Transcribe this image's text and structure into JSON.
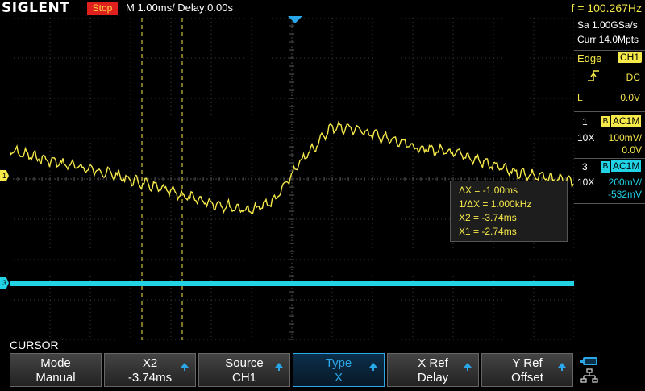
{
  "header": {
    "brand": "SIGLENT",
    "run_state": "Stop",
    "timebase": "M 1.00ms/ Delay:0.00s",
    "frequency": "f = 100.267Hz"
  },
  "acquisition": {
    "sample_rate": "Sa 1.00GSa/s",
    "memory": "Curr 14.0Mpts"
  },
  "trigger": {
    "type_label": "Edge",
    "source": "CH1",
    "coupling": "DC",
    "level_label": "L",
    "level_value": "0.0V"
  },
  "channels": [
    {
      "number": "1",
      "bw": "B",
      "coupling": "AC1M",
      "probe": "10X",
      "scale": "100mV/",
      "offset": "0.0V",
      "color": "#f6e94a"
    },
    {
      "number": "3",
      "bw": "B",
      "coupling": "AC1M",
      "probe": "10X",
      "scale": "200mV/",
      "offset": "-532mV",
      "color": "#22d3e6"
    }
  ],
  "cursor_readout": {
    "delta_x": "ΔX = -1.00ms",
    "inv_delta_x": "1/ΔX = 1.000kHz",
    "x2": "X2 = -3.74ms",
    "x1": "X1 = -2.74ms"
  },
  "menu": {
    "title": "CURSOR",
    "buttons": [
      {
        "label": "Mode",
        "value": "Manual",
        "arrow": false
      },
      {
        "label": "X2",
        "value": "-3.74ms",
        "arrow": true
      },
      {
        "label": "Source",
        "value": "CH1",
        "arrow": true
      },
      {
        "label": "Type",
        "value": "X",
        "arrow": true
      },
      {
        "label": "X Ref",
        "value": "Delay",
        "arrow": true
      },
      {
        "label": "Y Ref",
        "value": "Offset",
        "arrow": true
      }
    ]
  },
  "markers": {
    "ch1": "1",
    "ch3": "3"
  }
}
